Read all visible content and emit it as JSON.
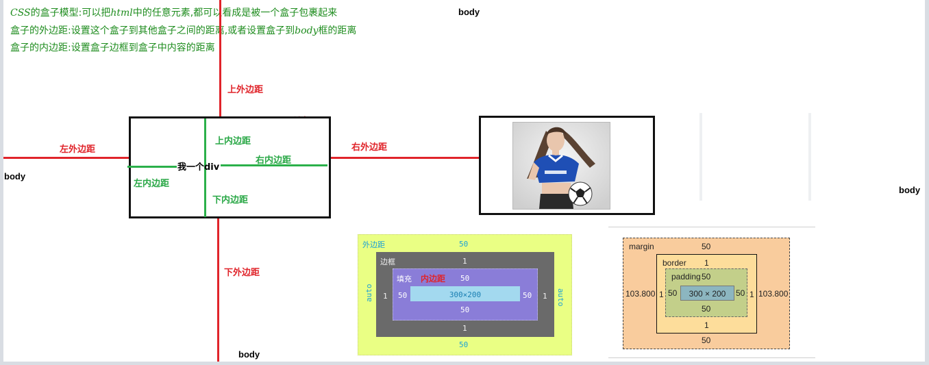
{
  "notes": {
    "line1_prefix": "CSS",
    "line1_mid1": "的盒子模型:可以把",
    "line1_html": "html",
    "line1_rest": "中的任意元素,都可以看成是被一个盒子包裹起来",
    "line2_prefix": "盒子的外边距:设置这个盒子到其他盒子之间的距离,或者设置盒子到",
    "line2_body": "body",
    "line2_rest": "框的距离",
    "line3": "盒子的内边距:设置盒子边框到盒子中内容的距离"
  },
  "labels": {
    "body": "body",
    "margin_top": "上外边距",
    "margin_left": "左外边距",
    "margin_right": "右外边距",
    "margin_bottom": "下外边距",
    "border": "边框",
    "padding_top": "上内边距",
    "padding_right": "右内边距",
    "padding_left": "左内边距",
    "padding_bottom": "下内边距",
    "content": "我一个div"
  },
  "devtools_cn": {
    "margin_label": "外边距",
    "border_label": "边框",
    "padding_label": "填充",
    "padding_label_red": "内边距",
    "margin_top": "50",
    "margin_bottom": "50",
    "margin_left": "auto",
    "margin_right": "auto",
    "border_top": "1",
    "border_bottom": "1",
    "border_left": "1",
    "border_right": "1",
    "padding_top": "50",
    "padding_bottom": "50",
    "padding_left": "50",
    "padding_right": "50",
    "content": "300×200"
  },
  "devtools_en": {
    "margin_label": "margin",
    "border_label": "border",
    "padding_label": "padding",
    "margin_top": "50",
    "margin_bottom": "50",
    "margin_left": "103.800",
    "margin_right": "103.800",
    "border_top": "1",
    "border_bottom": "1",
    "border_left": "1",
    "border_right": "1",
    "padding_top": "50",
    "padding_bottom": "50",
    "padding_left": "50",
    "padding_right": "50",
    "content": "300 × 200"
  },
  "colors": {
    "red": "#e0242a",
    "green": "#2bb04a",
    "note_green": "#1e8c1e"
  }
}
